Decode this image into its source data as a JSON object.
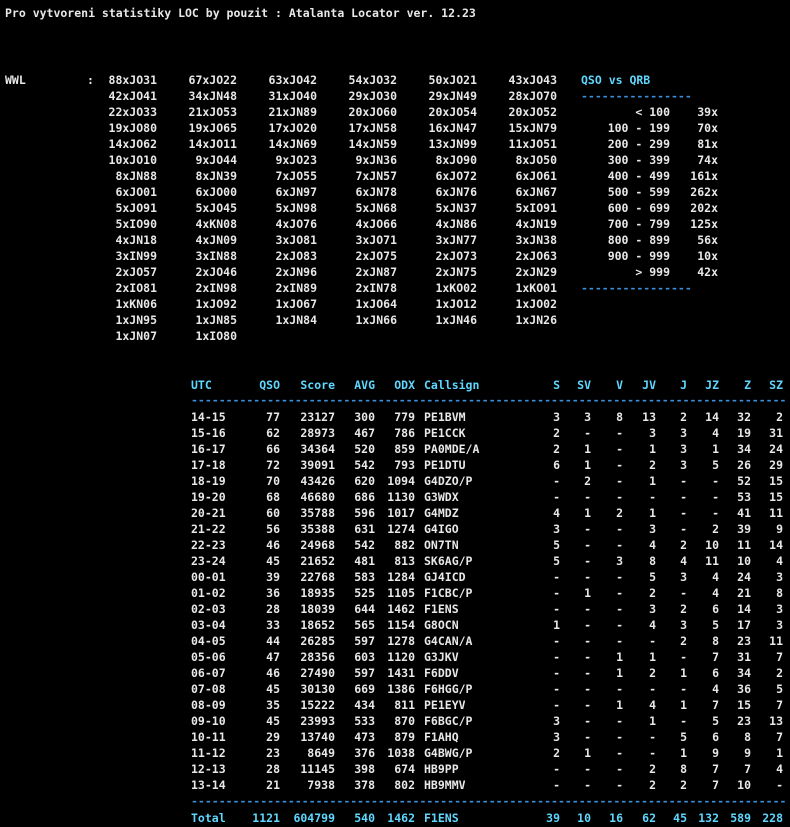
{
  "title": "Pro vytvoreni statistiky LOC by pouzit : Atalanta Locator ver. 12.23",
  "wwl": {
    "label": "WWL",
    "colon": ":",
    "rows": [
      [
        "88xJO31",
        "67xJO22",
        "63xJO42",
        "54xJO32",
        "50xJO21",
        "43xJO43"
      ],
      [
        "42xJO41",
        "34xJN48",
        "31xJO40",
        "29xJO30",
        "29xJN49",
        "28xJO70"
      ],
      [
        "22xJO33",
        "21xJO53",
        "21xJN89",
        "20xJO60",
        "20xJO54",
        "20xJO52"
      ],
      [
        "19xJO80",
        "19xJO65",
        "17xJO20",
        "17xJN58",
        "16xJN47",
        "15xJN79"
      ],
      [
        "14xJO62",
        "14xJO11",
        "14xJN69",
        "14xJN59",
        "13xJN99",
        "11xJO51"
      ],
      [
        "10xJO10",
        "9xJO44",
        "9xJO23",
        "9xJN36",
        "8xJO90",
        "8xJO50"
      ],
      [
        "8xJN88",
        "8xJN39",
        "7xJO55",
        "7xJN57",
        "6xJO72",
        "6xJO61"
      ],
      [
        "6xJO01",
        "6xJO00",
        "6xJN97",
        "6xJN78",
        "6xJN76",
        "6xJN67"
      ],
      [
        "5xJO91",
        "5xJO45",
        "5xJN98",
        "5xJN68",
        "5xJN37",
        "5xIO91"
      ],
      [
        "5xIO90",
        "4xKN08",
        "4xJO76",
        "4xJO66",
        "4xJN86",
        "4xJN19"
      ],
      [
        "4xJN18",
        "4xJN09",
        "3xJO81",
        "3xJO71",
        "3xJN77",
        "3xJN38"
      ],
      [
        "3xIN99",
        "3xIN88",
        "2xJO83",
        "2xJO75",
        "2xJO73",
        "2xJO63"
      ],
      [
        "2xJO57",
        "2xJO46",
        "2xJN96",
        "2xJN87",
        "2xJN75",
        "2xJN29"
      ],
      [
        "2xIO81",
        "2xIN98",
        "2xIN89",
        "2xIN78",
        "1xKO02",
        "1xKO01"
      ],
      [
        "1xKN06",
        "1xJO92",
        "1xJO67",
        "1xJO64",
        "1xJO12",
        "1xJO02"
      ],
      [
        "1xJN95",
        "1xJN85",
        "1xJN84",
        "1xJN66",
        "1xJN46",
        "1xJN26"
      ],
      [
        "1xJN07",
        "1xIO80"
      ]
    ]
  },
  "qrb": {
    "title": "QSO vs QRB",
    "separator": "----------------",
    "rows": [
      {
        "range": "< 100",
        "count": "39x"
      },
      {
        "range": "100 - 199",
        "count": "70x"
      },
      {
        "range": "200 - 299",
        "count": "81x"
      },
      {
        "range": "300 - 399",
        "count": "74x"
      },
      {
        "range": "400 - 499",
        "count": "161x"
      },
      {
        "range": "500 - 599",
        "count": "262x"
      },
      {
        "range": "600 - 699",
        "count": "202x"
      },
      {
        "range": "700 - 799",
        "count": "125x"
      },
      {
        "range": "800 - 899",
        "count": "56x"
      },
      {
        "range": "900 - 999",
        "count": "10x"
      },
      {
        "range": "> 999",
        "count": "42x"
      }
    ]
  },
  "hourly": {
    "headers": [
      "UTC",
      "QSO",
      "Score",
      "AVG",
      "ODX",
      "Callsign",
      "S",
      "SV",
      "V",
      "JV",
      "J",
      "JZ",
      "Z",
      "SZ"
    ],
    "separator": "---------------------------------------------------------------------------------------------",
    "rows": [
      [
        "14-15",
        "77",
        "23127",
        "300",
        "779",
        "PE1BVM",
        "3",
        "3",
        "8",
        "13",
        "2",
        "14",
        "32",
        "2"
      ],
      [
        "15-16",
        "62",
        "28973",
        "467",
        "786",
        "PE1CCK",
        "2",
        "-",
        "-",
        "3",
        "3",
        "4",
        "19",
        "31"
      ],
      [
        "16-17",
        "66",
        "34364",
        "520",
        "859",
        "PA0MDE/A",
        "2",
        "1",
        "-",
        "1",
        "3",
        "1",
        "34",
        "24"
      ],
      [
        "17-18",
        "72",
        "39091",
        "542",
        "793",
        "PE1DTU",
        "6",
        "1",
        "-",
        "2",
        "3",
        "5",
        "26",
        "29"
      ],
      [
        "18-19",
        "70",
        "43426",
        "620",
        "1094",
        "G4DZO/P",
        "-",
        "2",
        "-",
        "1",
        "-",
        "-",
        "52",
        "15"
      ],
      [
        "19-20",
        "68",
        "46680",
        "686",
        "1130",
        "G3WDX",
        "-",
        "-",
        "-",
        "-",
        "-",
        "-",
        "53",
        "15"
      ],
      [
        "20-21",
        "60",
        "35788",
        "596",
        "1017",
        "G4MDZ",
        "4",
        "1",
        "2",
        "1",
        "-",
        "-",
        "41",
        "11"
      ],
      [
        "21-22",
        "56",
        "35388",
        "631",
        "1274",
        "G4IGO",
        "3",
        "-",
        "-",
        "3",
        "-",
        "2",
        "39",
        "9"
      ],
      [
        "22-23",
        "46",
        "24968",
        "542",
        "882",
        "ON7TN",
        "5",
        "-",
        "-",
        "4",
        "2",
        "10",
        "11",
        "14"
      ],
      [
        "23-24",
        "45",
        "21652",
        "481",
        "813",
        "SK6AG/P",
        "5",
        "-",
        "3",
        "8",
        "4",
        "11",
        "10",
        "4"
      ],
      [
        "00-01",
        "39",
        "22768",
        "583",
        "1284",
        "GJ4ICD",
        "-",
        "-",
        "-",
        "5",
        "3",
        "4",
        "24",
        "3"
      ],
      [
        "01-02",
        "36",
        "18935",
        "525",
        "1105",
        "F1CBC/P",
        "-",
        "1",
        "-",
        "2",
        "-",
        "4",
        "21",
        "8"
      ],
      [
        "02-03",
        "28",
        "18039",
        "644",
        "1462",
        "F1ENS",
        "-",
        "-",
        "-",
        "3",
        "2",
        "6",
        "14",
        "3"
      ],
      [
        "03-04",
        "33",
        "18652",
        "565",
        "1154",
        "G8OCN",
        "1",
        "-",
        "-",
        "4",
        "3",
        "5",
        "17",
        "3"
      ],
      [
        "04-05",
        "44",
        "26285",
        "597",
        "1278",
        "G4CAN/A",
        "-",
        "-",
        "-",
        "-",
        "2",
        "8",
        "23",
        "11"
      ],
      [
        "05-06",
        "47",
        "28356",
        "603",
        "1120",
        "G3JKV",
        "-",
        "-",
        "1",
        "1",
        "-",
        "7",
        "31",
        "7"
      ],
      [
        "06-07",
        "46",
        "27490",
        "597",
        "1431",
        "F6DDV",
        "-",
        "-",
        "1",
        "2",
        "1",
        "6",
        "34",
        "2"
      ],
      [
        "07-08",
        "45",
        "30130",
        "669",
        "1386",
        "F6HGG/P",
        "-",
        "-",
        "-",
        "-",
        "-",
        "4",
        "36",
        "5"
      ],
      [
        "08-09",
        "35",
        "15222",
        "434",
        "811",
        "PE1EYV",
        "-",
        "-",
        "1",
        "4",
        "1",
        "7",
        "15",
        "7"
      ],
      [
        "09-10",
        "45",
        "23993",
        "533",
        "870",
        "F6BGC/P",
        "3",
        "-",
        "-",
        "1",
        "-",
        "5",
        "23",
        "13"
      ],
      [
        "10-11",
        "29",
        "13740",
        "473",
        "879",
        "F1AHQ",
        "3",
        "-",
        "-",
        "-",
        "5",
        "6",
        "8",
        "7"
      ],
      [
        "11-12",
        "23",
        "8649",
        "376",
        "1038",
        "G4BWG/P",
        "2",
        "1",
        "-",
        "-",
        "1",
        "9",
        "9",
        "1"
      ],
      [
        "12-13",
        "28",
        "11145",
        "398",
        "674",
        "HB9PP",
        "-",
        "-",
        "-",
        "2",
        "8",
        "7",
        "7",
        "4"
      ],
      [
        "13-14",
        "21",
        "7938",
        "378",
        "802",
        "HB9MMV",
        "-",
        "-",
        "-",
        "2",
        "2",
        "7",
        "10",
        "-"
      ]
    ],
    "totals": [
      "Total",
      "1121",
      "604799",
      "540",
      "1462",
      "F1ENS",
      "39",
      "10",
      "16",
      "62",
      "45",
      "132",
      "589",
      "228"
    ]
  }
}
